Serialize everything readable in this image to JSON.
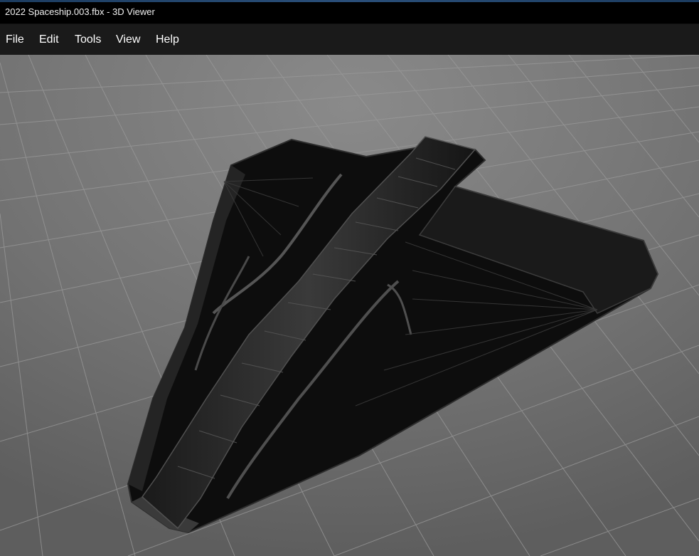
{
  "window": {
    "title": "2022 Spaceship.003.fbx - 3D Viewer"
  },
  "menu": {
    "items": [
      "File",
      "Edit",
      "Tools",
      "View",
      "Help"
    ]
  },
  "colors": {
    "titlebar": "#000000",
    "menubar": "#1a1a1a",
    "viewport_bg": "#707070",
    "grid_line": "#8e8e8e",
    "model": "#0c0c0c",
    "model_edge": "#4a4a4a"
  },
  "viewport": {
    "content": "3D model",
    "model_icon": "spaceship-model"
  }
}
